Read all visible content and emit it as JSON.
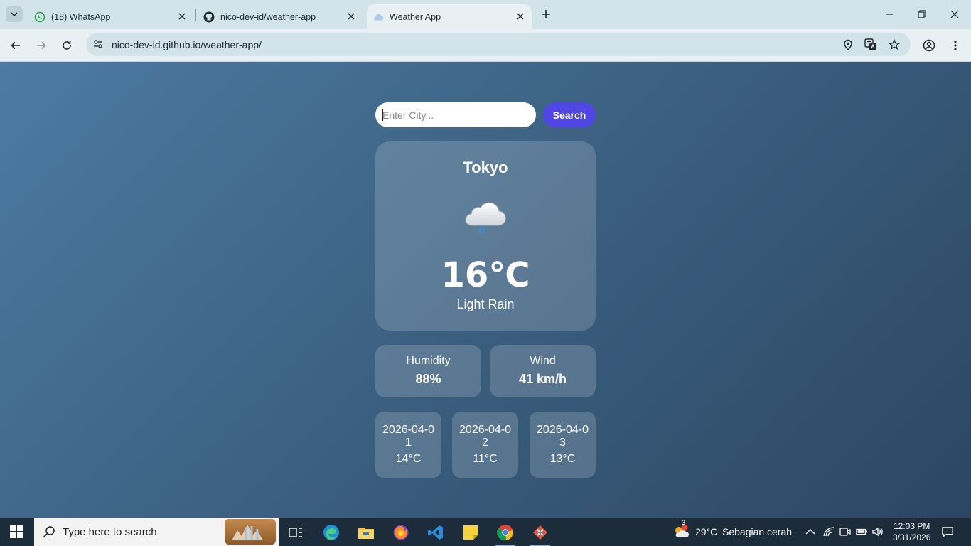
{
  "tabs": [
    {
      "title": "(18) WhatsApp",
      "icon": "whatsapp-icon"
    },
    {
      "title": "nico-dev-id/weather-app",
      "icon": "github-icon"
    },
    {
      "title": "Weather App",
      "icon": "cloud-icon",
      "active": true
    }
  ],
  "address_bar": {
    "url": "nico-dev-id.github.io/weather-app/"
  },
  "search": {
    "placeholder": "Enter City...",
    "value": "",
    "button_label": "Search"
  },
  "weather": {
    "city": "Tokyo",
    "icon": "rain-cloud-icon",
    "temperature": "16℃",
    "description": "Light Rain",
    "humidity": {
      "label": "Humidity",
      "value": "88%"
    },
    "wind": {
      "label": "Wind",
      "value": "41 km/h"
    }
  },
  "forecast": [
    {
      "date": "2026-04-01",
      "temp": "14°C"
    },
    {
      "date": "2026-04-02",
      "temp": "11°C"
    },
    {
      "date": "2026-04-03",
      "temp": "13°C"
    }
  ],
  "taskbar": {
    "search_placeholder": "Type here to search",
    "weather_temp": "29°C",
    "weather_desc": "Sebagian cerah",
    "weather_badge": "3",
    "time": "12:03 PM",
    "date": "3/31/2026"
  },
  "colors": {
    "accent": "#4f46e5",
    "page_bg_start": "#4c7ba3",
    "page_bg_end": "#2b4662"
  }
}
